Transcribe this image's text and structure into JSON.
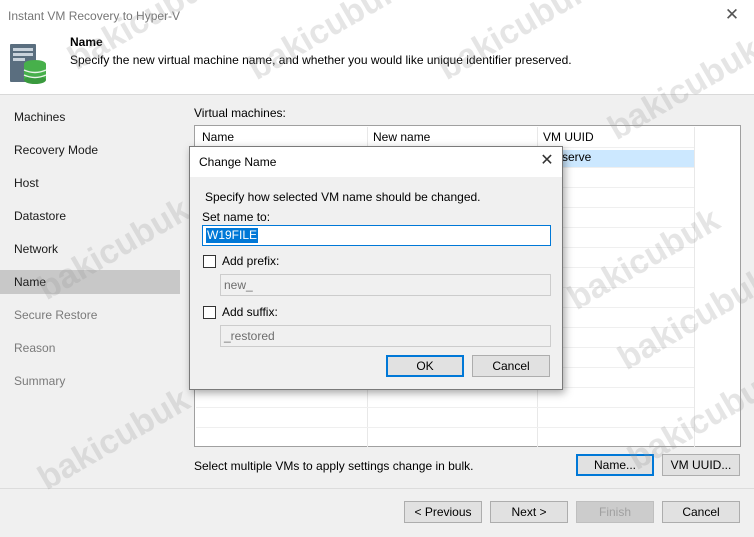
{
  "window": {
    "title": "Instant VM Recovery to Hyper-V",
    "close_glyph": "✕"
  },
  "header": {
    "icon": "vm-database-icon",
    "step_title": "Name",
    "step_description": "Specify the new virtual machine name, and whether you would like unique identifier preserved."
  },
  "sidebar": {
    "items": [
      {
        "label": "Machines"
      },
      {
        "label": "Recovery Mode"
      },
      {
        "label": "Host"
      },
      {
        "label": "Datastore"
      },
      {
        "label": "Network"
      },
      {
        "label": "Name"
      },
      {
        "label": "Secure Restore"
      },
      {
        "label": "Reason"
      },
      {
        "label": "Summary"
      }
    ]
  },
  "main": {
    "vm_label": "Virtual machines:",
    "columns": [
      "Name",
      "New name",
      "VM UUID"
    ],
    "selected_row_uuid": "serve",
    "bulk_hint": "Select multiple VMs to apply settings change in bulk.",
    "name_button": "Name...",
    "uuid_button": "VM UUID..."
  },
  "footer": {
    "previous": "< Previous",
    "next": "Next >",
    "finish": "Finish",
    "cancel": "Cancel"
  },
  "dialog": {
    "title": "Change Name",
    "close_glyph": "✕",
    "description": "Specify how selected VM name should be changed.",
    "set_name_label": "Set name to:",
    "set_name_value": "W19FILE",
    "prefix_label": "Add prefix:",
    "prefix_value": "new_",
    "suffix_label": "Add suffix:",
    "suffix_value": "_restored",
    "ok": "OK",
    "cancel": "Cancel"
  },
  "watermark": "bakicubuk",
  "colors": {
    "accent": "#0078d7",
    "selection": "#cce8ff",
    "active_step": "#c8c8c8"
  }
}
